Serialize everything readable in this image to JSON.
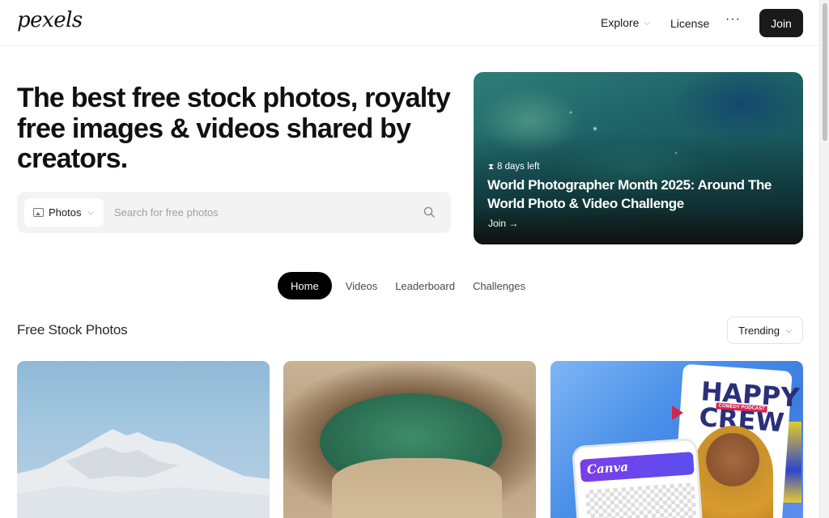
{
  "header": {
    "logo": "pexels",
    "nav": {
      "explore": "Explore",
      "license": "License",
      "more": "···",
      "join": "Join"
    }
  },
  "hero": {
    "title": "The best free stock photos, royalty free images & videos shared by creators.",
    "search": {
      "type": "Photos",
      "placeholder": "Search for free photos"
    }
  },
  "challenge": {
    "days_left": "8 days left",
    "title": "World Photographer Month 2025: Around The World Photo & Video Challenge",
    "cta": "Join →"
  },
  "tabs": [
    "Home",
    "Videos",
    "Leaderboard",
    "Challenges"
  ],
  "active_tab": "Home",
  "section": {
    "title": "Free Stock Photos",
    "sort": "Trending"
  },
  "photos": [
    {
      "subject": "snow-mountain"
    },
    {
      "subject": "sinkhole-pool"
    },
    {
      "subject": "canva-ad",
      "poster_text": "HAPPY CREW",
      "poster_sub": "COMEDY PODCAST",
      "app_logo": "Canva"
    }
  ],
  "colors": {
    "primary": "#1a1a1a",
    "search_bg": "#f3f3f3",
    "tab_active_bg": "#000000"
  },
  "icons": [
    "chevron-down-icon",
    "more-icon",
    "image-icon",
    "search-icon",
    "hourglass-icon",
    "arrow-right-icon"
  ]
}
